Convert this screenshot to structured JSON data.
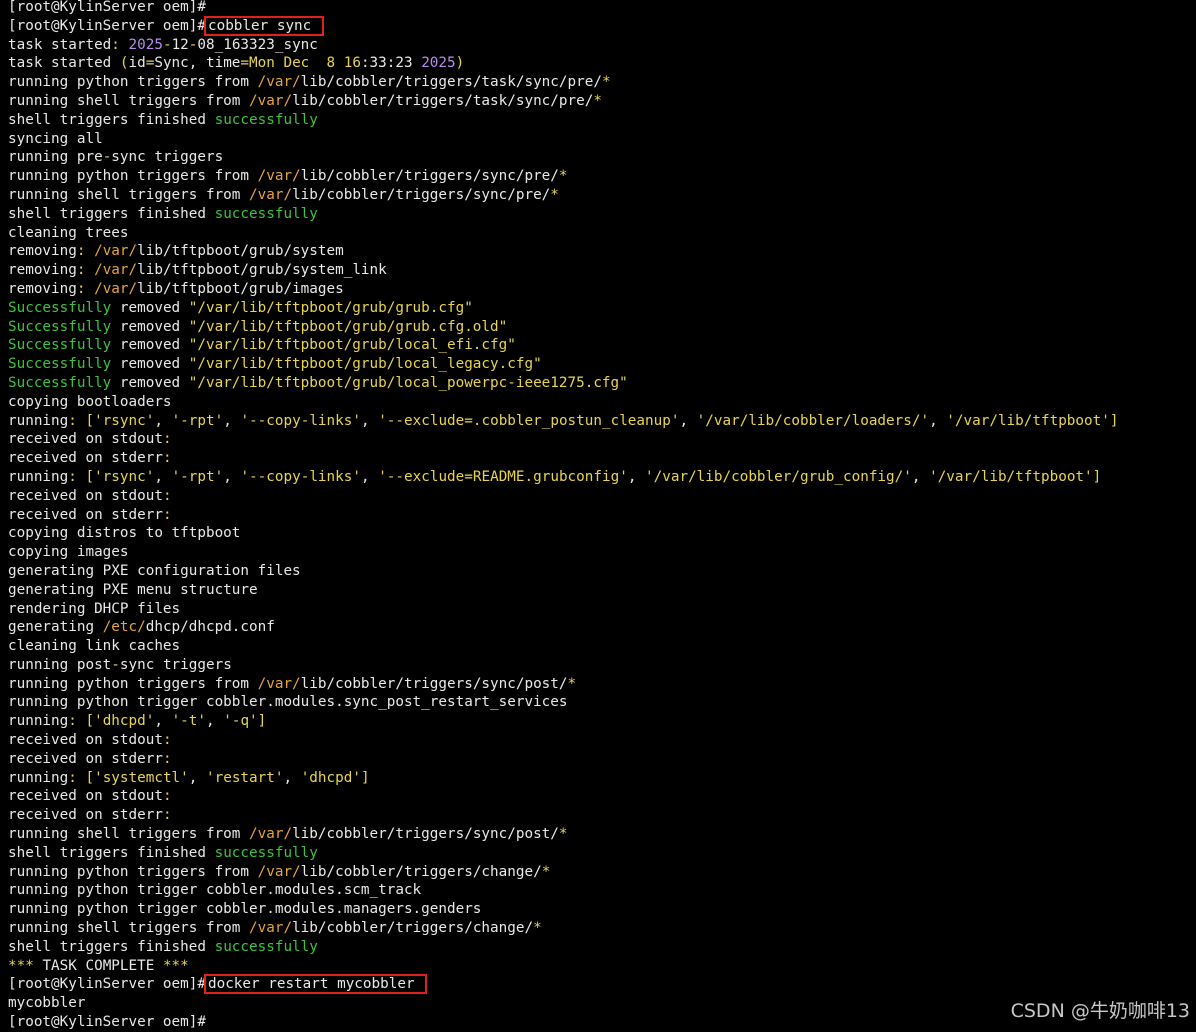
{
  "terminal": {
    "colors": {
      "background": "#000000",
      "default": "#e8e8e8",
      "yellow": "#e8d44d",
      "orange": "#e8a33a",
      "green": "#3fc23f",
      "purple": "#b68cf0",
      "highlight_box": "#e0201e"
    },
    "lines": [
      [
        {
          "t": "[root@KylinServer oem]# ",
          "c": "default"
        }
      ],
      [
        {
          "t": "[root@KylinServer oem]#",
          "c": "default"
        },
        {
          "t": "cobbler sync ",
          "c": "default",
          "box": true
        }
      ],
      [
        {
          "t": "task started",
          "c": "default"
        },
        {
          "t": ": ",
          "c": "yellow"
        },
        {
          "t": "2025",
          "c": "purple"
        },
        {
          "t": "-",
          "c": "yellow"
        },
        {
          "t": "12",
          "c": "default"
        },
        {
          "t": "-",
          "c": "yellow"
        },
        {
          "t": "08_163323_sync",
          "c": "default"
        }
      ],
      [
        {
          "t": "task started ",
          "c": "default"
        },
        {
          "t": "(",
          "c": "yellow"
        },
        {
          "t": "id",
          "c": "default"
        },
        {
          "t": "=",
          "c": "yellow"
        },
        {
          "t": "Sync, time",
          "c": "default"
        },
        {
          "t": "=",
          "c": "yellow"
        },
        {
          "t": "Mon Dec  8 16",
          "c": "yellow"
        },
        {
          "t": ":33:23 ",
          "c": "default"
        },
        {
          "t": "2025",
          "c": "purple"
        },
        {
          "t": ")",
          "c": "yellow"
        }
      ],
      [
        {
          "t": "running python triggers from ",
          "c": "default"
        },
        {
          "t": "/var/",
          "c": "orange"
        },
        {
          "t": "lib/cobbler/triggers/task/sync/pre/",
          "c": "default"
        },
        {
          "t": "*",
          "c": "yellow"
        }
      ],
      [
        {
          "t": "running shell triggers from ",
          "c": "default"
        },
        {
          "t": "/var/",
          "c": "orange"
        },
        {
          "t": "lib/cobbler/triggers/task/sync/pre/",
          "c": "default"
        },
        {
          "t": "*",
          "c": "yellow"
        }
      ],
      [
        {
          "t": "shell triggers finished ",
          "c": "default"
        },
        {
          "t": "successfully",
          "c": "green"
        }
      ],
      [
        {
          "t": "syncing all",
          "c": "default"
        }
      ],
      [
        {
          "t": "running pre",
          "c": "default"
        },
        {
          "t": "-",
          "c": "yellow"
        },
        {
          "t": "sync triggers",
          "c": "default"
        }
      ],
      [
        {
          "t": "running python triggers from ",
          "c": "default"
        },
        {
          "t": "/var/",
          "c": "orange"
        },
        {
          "t": "lib/cobbler/triggers/sync/pre/",
          "c": "default"
        },
        {
          "t": "*",
          "c": "yellow"
        }
      ],
      [
        {
          "t": "running shell triggers from ",
          "c": "default"
        },
        {
          "t": "/var/",
          "c": "orange"
        },
        {
          "t": "lib/cobbler/triggers/sync/pre/",
          "c": "default"
        },
        {
          "t": "*",
          "c": "yellow"
        }
      ],
      [
        {
          "t": "shell triggers finished ",
          "c": "default"
        },
        {
          "t": "successfully",
          "c": "green"
        }
      ],
      [
        {
          "t": "cleaning trees",
          "c": "default"
        }
      ],
      [
        {
          "t": "removing",
          "c": "default"
        },
        {
          "t": ": ",
          "c": "yellow"
        },
        {
          "t": "/var/",
          "c": "orange"
        },
        {
          "t": "lib/tftpboot/grub/system",
          "c": "default"
        }
      ],
      [
        {
          "t": "removing",
          "c": "default"
        },
        {
          "t": ": ",
          "c": "yellow"
        },
        {
          "t": "/var/",
          "c": "orange"
        },
        {
          "t": "lib/tftpboot/grub/system_link",
          "c": "default"
        }
      ],
      [
        {
          "t": "removing",
          "c": "default"
        },
        {
          "t": ": ",
          "c": "yellow"
        },
        {
          "t": "/var/",
          "c": "orange"
        },
        {
          "t": "lib/tftpboot/grub/images",
          "c": "default"
        }
      ],
      [
        {
          "t": "Successfully",
          "c": "green"
        },
        {
          "t": " removed ",
          "c": "default"
        },
        {
          "t": "\"/var/lib/tftpboot/grub/grub.cfg\"",
          "c": "yellow"
        }
      ],
      [
        {
          "t": "Successfully",
          "c": "green"
        },
        {
          "t": " removed ",
          "c": "default"
        },
        {
          "t": "\"/var/lib/tftpboot/grub/grub.cfg.old\"",
          "c": "yellow"
        }
      ],
      [
        {
          "t": "Successfully",
          "c": "green"
        },
        {
          "t": " removed ",
          "c": "default"
        },
        {
          "t": "\"/var/lib/tftpboot/grub/local_efi.cfg\"",
          "c": "yellow"
        }
      ],
      [
        {
          "t": "Successfully",
          "c": "green"
        },
        {
          "t": " removed ",
          "c": "default"
        },
        {
          "t": "\"/var/lib/tftpboot/grub/local_legacy.cfg\"",
          "c": "yellow"
        }
      ],
      [
        {
          "t": "Successfully",
          "c": "green"
        },
        {
          "t": " removed ",
          "c": "default"
        },
        {
          "t": "\"/var/lib/tftpboot/grub/local_powerpc-ieee1275.cfg\"",
          "c": "yellow"
        }
      ],
      [
        {
          "t": "copying bootloaders",
          "c": "default"
        }
      ],
      [
        {
          "t": "running",
          "c": "default"
        },
        {
          "t": ": [",
          "c": "yellow"
        },
        {
          "t": "'rsync'",
          "c": "yellow"
        },
        {
          "t": ", ",
          "c": "default"
        },
        {
          "t": "'-rpt'",
          "c": "yellow"
        },
        {
          "t": ", ",
          "c": "default"
        },
        {
          "t": "'--copy-links'",
          "c": "yellow"
        },
        {
          "t": ", ",
          "c": "default"
        },
        {
          "t": "'--exclude=.cobbler_postun_cleanup'",
          "c": "yellow"
        },
        {
          "t": ", ",
          "c": "default"
        },
        {
          "t": "'/var/lib/cobbler/loaders/'",
          "c": "yellow"
        },
        {
          "t": ", ",
          "c": "default"
        },
        {
          "t": "'/var/lib/tftpboot'",
          "c": "yellow"
        },
        {
          "t": "]",
          "c": "yellow"
        }
      ],
      [
        {
          "t": "received on stdout",
          "c": "default"
        },
        {
          "t": ":",
          "c": "yellow"
        }
      ],
      [
        {
          "t": "received on stderr",
          "c": "default"
        },
        {
          "t": ":",
          "c": "yellow"
        }
      ],
      [
        {
          "t": "running",
          "c": "default"
        },
        {
          "t": ": [",
          "c": "yellow"
        },
        {
          "t": "'rsync'",
          "c": "yellow"
        },
        {
          "t": ", ",
          "c": "default"
        },
        {
          "t": "'-rpt'",
          "c": "yellow"
        },
        {
          "t": ", ",
          "c": "default"
        },
        {
          "t": "'--copy-links'",
          "c": "yellow"
        },
        {
          "t": ", ",
          "c": "default"
        },
        {
          "t": "'--exclude=README.grubconfig'",
          "c": "yellow"
        },
        {
          "t": ", ",
          "c": "default"
        },
        {
          "t": "'/var/lib/cobbler/grub_config/'",
          "c": "yellow"
        },
        {
          "t": ", ",
          "c": "default"
        },
        {
          "t": "'/var/lib/tftpboot'",
          "c": "yellow"
        },
        {
          "t": "]",
          "c": "yellow"
        }
      ],
      [
        {
          "t": "received on stdout",
          "c": "default"
        },
        {
          "t": ":",
          "c": "yellow"
        }
      ],
      [
        {
          "t": "received on stderr",
          "c": "default"
        },
        {
          "t": ":",
          "c": "yellow"
        }
      ],
      [
        {
          "t": "copying distros to tftpboot",
          "c": "default"
        }
      ],
      [
        {
          "t": "copying images",
          "c": "default"
        }
      ],
      [
        {
          "t": "generating PXE configuration files",
          "c": "default"
        }
      ],
      [
        {
          "t": "generating PXE menu structure",
          "c": "default"
        }
      ],
      [
        {
          "t": "rendering DHCP files",
          "c": "default"
        }
      ],
      [
        {
          "t": "generating ",
          "c": "default"
        },
        {
          "t": "/etc/",
          "c": "orange"
        },
        {
          "t": "dhcp/dhcpd.conf",
          "c": "default"
        }
      ],
      [
        {
          "t": "cleaning link caches",
          "c": "default"
        }
      ],
      [
        {
          "t": "running post",
          "c": "default"
        },
        {
          "t": "-",
          "c": "yellow"
        },
        {
          "t": "sync triggers",
          "c": "default"
        }
      ],
      [
        {
          "t": "running python triggers from ",
          "c": "default"
        },
        {
          "t": "/var/",
          "c": "orange"
        },
        {
          "t": "lib/cobbler/triggers/sync/post/",
          "c": "default"
        },
        {
          "t": "*",
          "c": "yellow"
        }
      ],
      [
        {
          "t": "running python trigger cobbler.modules.sync_post_restart_services",
          "c": "default"
        }
      ],
      [
        {
          "t": "running",
          "c": "default"
        },
        {
          "t": ": [",
          "c": "yellow"
        },
        {
          "t": "'dhcpd'",
          "c": "yellow"
        },
        {
          "t": ", ",
          "c": "default"
        },
        {
          "t": "'-t'",
          "c": "yellow"
        },
        {
          "t": ", ",
          "c": "default"
        },
        {
          "t": "'-q'",
          "c": "yellow"
        },
        {
          "t": "]",
          "c": "yellow"
        }
      ],
      [
        {
          "t": "received on stdout",
          "c": "default"
        },
        {
          "t": ":",
          "c": "yellow"
        }
      ],
      [
        {
          "t": "received on stderr",
          "c": "default"
        },
        {
          "t": ":",
          "c": "yellow"
        }
      ],
      [
        {
          "t": "running",
          "c": "default"
        },
        {
          "t": ": [",
          "c": "yellow"
        },
        {
          "t": "'systemctl'",
          "c": "yellow"
        },
        {
          "t": ", ",
          "c": "default"
        },
        {
          "t": "'restart'",
          "c": "yellow"
        },
        {
          "t": ", ",
          "c": "default"
        },
        {
          "t": "'dhcpd'",
          "c": "yellow"
        },
        {
          "t": "]",
          "c": "yellow"
        }
      ],
      [
        {
          "t": "received on stdout",
          "c": "default"
        },
        {
          "t": ":",
          "c": "yellow"
        }
      ],
      [
        {
          "t": "received on stderr",
          "c": "default"
        },
        {
          "t": ":",
          "c": "yellow"
        }
      ],
      [
        {
          "t": "running shell triggers from ",
          "c": "default"
        },
        {
          "t": "/var/",
          "c": "orange"
        },
        {
          "t": "lib/cobbler/triggers/sync/post/",
          "c": "default"
        },
        {
          "t": "*",
          "c": "yellow"
        }
      ],
      [
        {
          "t": "shell triggers finished ",
          "c": "default"
        },
        {
          "t": "successfully",
          "c": "green"
        }
      ],
      [
        {
          "t": "running python triggers from ",
          "c": "default"
        },
        {
          "t": "/var/",
          "c": "orange"
        },
        {
          "t": "lib/cobbler/triggers/change/",
          "c": "default"
        },
        {
          "t": "*",
          "c": "yellow"
        }
      ],
      [
        {
          "t": "running python trigger cobbler.modules.scm_track",
          "c": "default"
        }
      ],
      [
        {
          "t": "running python trigger cobbler.modules.managers.genders",
          "c": "default"
        }
      ],
      [
        {
          "t": "running shell triggers from ",
          "c": "default"
        },
        {
          "t": "/var/",
          "c": "orange"
        },
        {
          "t": "lib/cobbler/triggers/change/",
          "c": "default"
        },
        {
          "t": "*",
          "c": "yellow"
        }
      ],
      [
        {
          "t": "shell triggers finished ",
          "c": "default"
        },
        {
          "t": "successfully",
          "c": "green"
        }
      ],
      [
        {
          "t": "*** ",
          "c": "yellow"
        },
        {
          "t": "TASK COMPLETE ",
          "c": "default"
        },
        {
          "t": "***",
          "c": "yellow"
        }
      ],
      [
        {
          "t": "[root@KylinServer oem]#",
          "c": "default"
        },
        {
          "t": "docker restart mycobbler ",
          "c": "default",
          "box": true
        }
      ],
      [
        {
          "t": "mycobbler",
          "c": "default"
        }
      ],
      [
        {
          "t": "[root@KylinServer oem]#",
          "c": "default"
        }
      ]
    ]
  },
  "watermark": {
    "text": "CSDN @牛奶咖啡13"
  }
}
